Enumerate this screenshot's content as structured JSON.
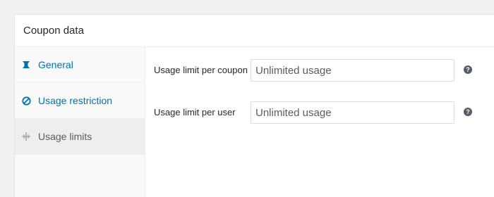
{
  "panel": {
    "title": "Coupon data"
  },
  "tabs": [
    {
      "label": "General",
      "icon": "ticket-icon"
    },
    {
      "label": "Usage restriction",
      "icon": "block-icon"
    },
    {
      "label": "Usage limits",
      "icon": "limits-icon"
    }
  ],
  "fields": {
    "per_coupon": {
      "label": "Usage limit per coupon",
      "placeholder": "Unlimited usage",
      "help": "?"
    },
    "per_user": {
      "label": "Usage limit per user",
      "placeholder": "Unlimited usage",
      "help": "?"
    }
  },
  "colors": {
    "accent": "#0073aa",
    "active_tab_bg": "#eeeeee"
  }
}
